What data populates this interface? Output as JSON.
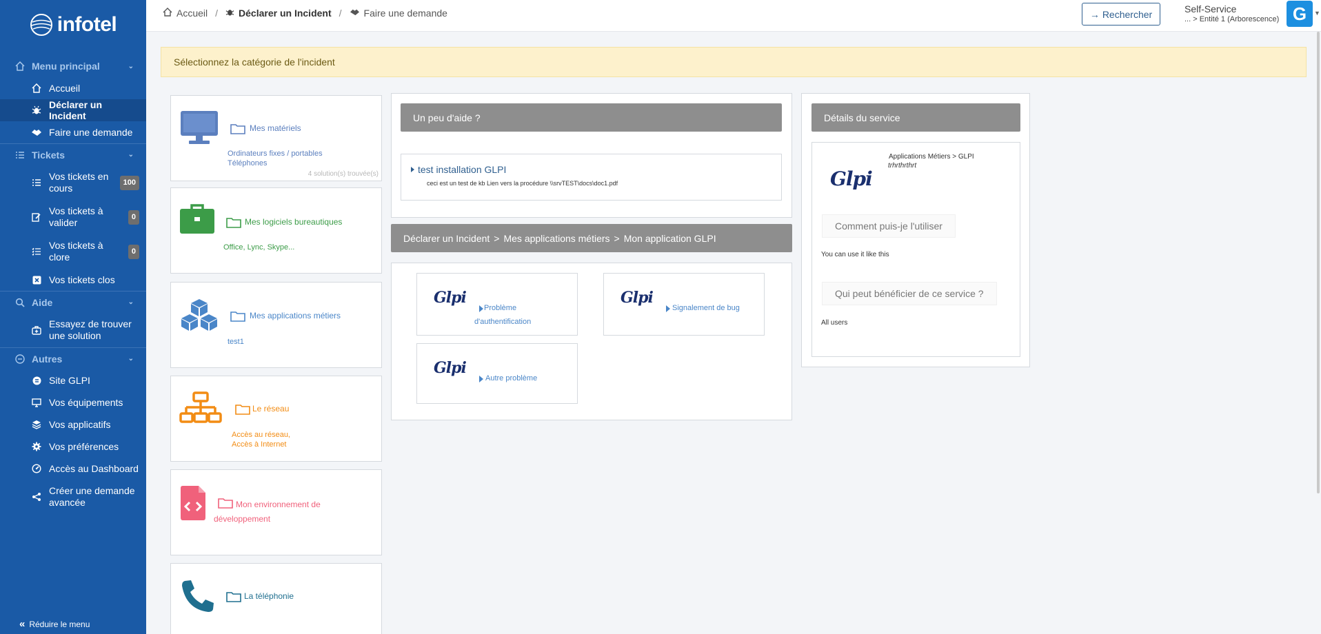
{
  "app": {
    "brand": "infotel"
  },
  "sidebar": {
    "sections": {
      "main": "Menu principal",
      "tickets": "Tickets",
      "help": "Aide",
      "others": "Autres"
    },
    "items": {
      "home": "Accueil",
      "declare": "Déclarer un Incident",
      "request": "Faire une demande",
      "tickets_open": "Vos tickets en cours",
      "tickets_open_count": "100",
      "tickets_validate": "Vos tickets à valider",
      "tickets_validate_count": "0",
      "tickets_close": "Vos tickets à clore",
      "tickets_close_count": "0",
      "tickets_closed": "Vos tickets clos",
      "find_solution": "Essayez de trouver une solution",
      "site": "Site GLPI",
      "equipment": "Vos équipements",
      "apps": "Vos applicatifs",
      "prefs": "Vos préférences",
      "dashboard": "Accès au Dashboard",
      "advanced": "Créer une demande avancée"
    },
    "reduce": "Réduire le menu"
  },
  "topbar": {
    "breadcrumb": {
      "home": "Accueil",
      "declare": "Déclarer un Incident",
      "request": "Faire une demande"
    },
    "search": "Rechercher",
    "profile": "Self-Service",
    "entity": "... > Entité 1 (Arborescence)",
    "avatar_letter": "G"
  },
  "alert": "Sélectionnez la catégorie de l'incident",
  "categories": [
    {
      "title": "Mes matériels",
      "desc1": "Ordinateurs fixes / portables",
      "desc2": "Téléphones",
      "footer": "4 solution(s) trouvée(s)",
      "color": "#5b7fbe",
      "icon": "monitor-icon"
    },
    {
      "title": "Mes logiciels bureautiques",
      "desc1": "Office, Lync, Skype...",
      "color": "#3c9c48",
      "icon": "briefcase-icon"
    },
    {
      "title": "Mes applications métiers",
      "desc1": "test1",
      "color": "#4a86c8",
      "icon": "cubes-icon"
    },
    {
      "title": "Le réseau",
      "desc1": "Accès au réseau,",
      "desc2": "Accès à Internet",
      "color": "#f28c14",
      "icon": "network-icon"
    },
    {
      "title": "Mon environnement de développement",
      "color": "#f0617b",
      "icon": "code-file-icon"
    },
    {
      "title": "La téléphonie",
      "color": "#1f6f8f",
      "icon": "phone-icon"
    }
  ],
  "help": {
    "title": "Un peu d'aide ?",
    "kb_title": "test installation GLPI",
    "kb_desc": "ceci est un test de kb Lien vers la procédure \\\\srvTEST\\docs\\doc1.pdf"
  },
  "path": {
    "p1": "Déclarer un Incident",
    "p2": "Mes applications métiers",
    "p3": "Mon application GLPI",
    "sep": ">"
  },
  "tiles": [
    {
      "logo": "Glpi",
      "label1": "Problème",
      "label2": "d'authentification"
    },
    {
      "logo": "Glpi",
      "label1": "Signalement de bug"
    },
    {
      "logo": "Glpi",
      "label1": "Autre problème"
    }
  ],
  "service": {
    "title": "Détails du service",
    "logo": "Glpi",
    "path": "Applications Métiers > GLPI",
    "subtitle": "trhrthrthrt",
    "q1": "Comment puis-je l'utiliser",
    "a1": "You can use it like this",
    "q2": "Qui peut bénéficier de ce service ?",
    "a2": "All users"
  }
}
